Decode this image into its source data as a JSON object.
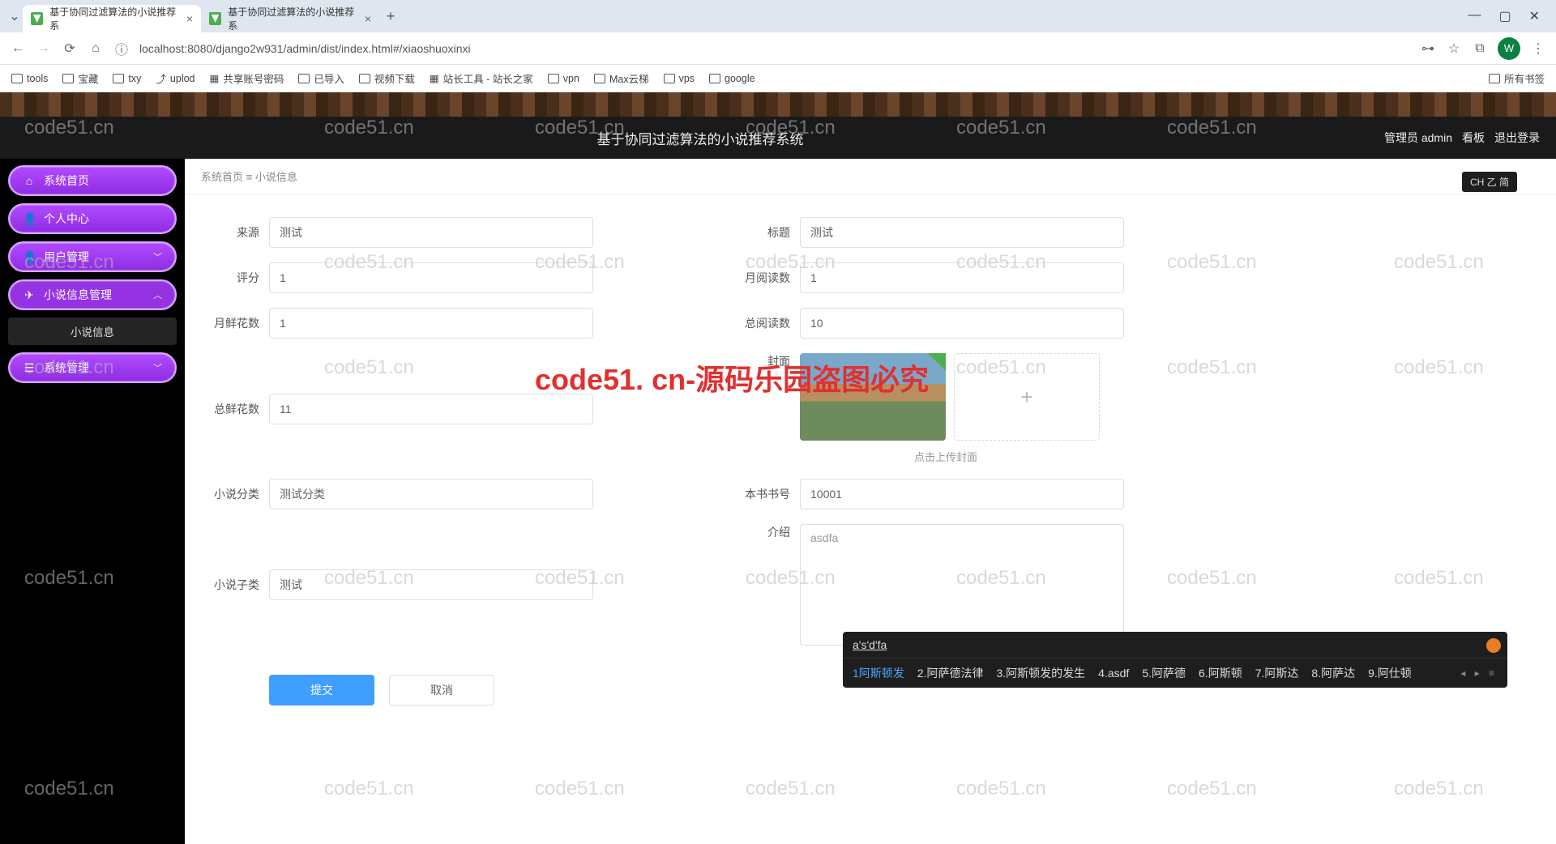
{
  "browser": {
    "tabs": [
      {
        "title": "基于协同过滤算法的小说推荐系"
      },
      {
        "title": "基于协同过滤算法的小说推荐系"
      }
    ],
    "url": "localhost:8080/django2w931/admin/dist/index.html#/xiaoshuoxinxi",
    "avatar_letter": "W",
    "bookmarks": [
      "tools",
      "宝藏",
      "txy",
      "uplod",
      "共享账号密码",
      "已导入",
      "视频下载",
      "站长工具 - 站长之家",
      "vpn",
      "Max云梯",
      "vps",
      "google"
    ],
    "all_bookmarks": "所有书签"
  },
  "header": {
    "title": "基于协同过滤算法的小说推荐系统",
    "right": [
      "管理员 admin",
      "看板",
      "退出登录"
    ]
  },
  "lang_indicator": "CH 乙 简",
  "sidebar": {
    "items": [
      {
        "icon": "⌂",
        "label": "系统首页"
      },
      {
        "icon": "👤",
        "label": "个人中心"
      },
      {
        "icon": "👤",
        "label": "用户管理",
        "expandable": true
      },
      {
        "icon": "✎",
        "label": "小说信息管理",
        "expandable": true,
        "open": true,
        "children": [
          {
            "label": "小说信息"
          }
        ]
      },
      {
        "icon": "☰",
        "label": "系统管理",
        "expandable": true
      }
    ]
  },
  "crumb": {
    "root": "系统首页",
    "sep": "≡",
    "current": "小说信息"
  },
  "form": {
    "laiyuan": {
      "label": "来源",
      "value": "测试"
    },
    "biaoti": {
      "label": "标题",
      "value": "测试"
    },
    "pingfen": {
      "label": "评分",
      "value": "1"
    },
    "yueyuedushu": {
      "label": "月阅读数",
      "value": "1"
    },
    "yuexianhua": {
      "label": "月鲜花数",
      "value": "1"
    },
    "zongyuedu": {
      "label": "总阅读数",
      "value": "10"
    },
    "zongxianhua": {
      "label": "总鲜花数",
      "value": "11"
    },
    "fengmian": {
      "label": "封面",
      "hint": "点击上传封面"
    },
    "xiaoshuofenlei": {
      "label": "小说分类",
      "value": "测试分类"
    },
    "benshuhao": {
      "label": "本书书号",
      "value": "10001"
    },
    "xiaoshuozilei": {
      "label": "小说子类",
      "value": "测试"
    },
    "jieshao": {
      "label": "介绍",
      "value": "asdfa"
    },
    "submit": "提交",
    "cancel": "取消"
  },
  "ime": {
    "input": "a's'd'fa",
    "candidates": [
      "阿斯顿发",
      "阿萨德法律",
      "阿斯顿发的发生",
      "asdf",
      "阿萨德",
      "阿斯顿",
      "阿斯达",
      "阿萨达",
      "阿仕顿"
    ]
  },
  "watermark": "code51.cn",
  "watermark_red": "code51. cn-源码乐园盗图必究"
}
